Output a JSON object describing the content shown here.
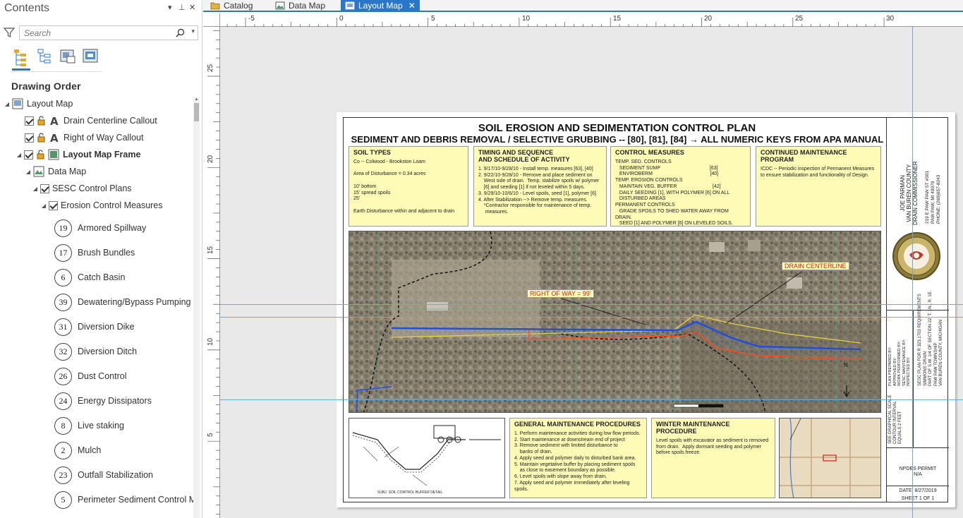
{
  "contents": {
    "title": "Contents",
    "search_placeholder": "Search",
    "drawing_order_label": "Drawing Order",
    "tree": [
      {
        "label": "Layout Map"
      },
      {
        "label": "Drain Centerline Callout"
      },
      {
        "label": "Right of Way Callout"
      },
      {
        "label": "Layout Map Frame"
      },
      {
        "label": "Data Map"
      },
      {
        "label": "SESC Control Plans"
      },
      {
        "label": "Erosion Control Measures"
      }
    ],
    "legend": [
      {
        "num": "19",
        "label": "Armored Spillway"
      },
      {
        "num": "17",
        "label": "Brush Bundles"
      },
      {
        "num": "6",
        "label": "Catch Basin"
      },
      {
        "num": "39",
        "label": "Dewatering/Bypass Pumping"
      },
      {
        "num": "31",
        "label": "Diversion Dike"
      },
      {
        "num": "32",
        "label": "Diversion Ditch"
      },
      {
        "num": "26",
        "label": "Dust Control"
      },
      {
        "num": "24",
        "label": "Energy Dissipators"
      },
      {
        "num": "8",
        "label": "Live staking"
      },
      {
        "num": "2",
        "label": "Mulch"
      },
      {
        "num": "23",
        "label": "Outfall Stabilization"
      },
      {
        "num": "5",
        "label": "Perimeter Sediment Control M"
      }
    ]
  },
  "tabs": [
    {
      "label": "Catalog"
    },
    {
      "label": "Data Map"
    },
    {
      "label": "Layout Map",
      "active": true
    }
  ],
  "rulers": {
    "h_ticks": [
      "-5",
      "0",
      "5",
      "10",
      "15",
      "20",
      "25",
      "30"
    ],
    "v_ticks": [
      "25",
      "20",
      "15",
      "10",
      "5"
    ]
  },
  "sheet": {
    "title": "SOIL EROSION AND SEDIMENTATION CONTROL PLAN",
    "subtitle": "SEDIMENT AND DEBRIS REMOVAL / SELECTIVE GRUBBING -- [80], [81], [84] → ALL NUMERIC KEYS FROM APA MANUAL",
    "boxes": [
      {
        "title": "SOIL TYPES",
        "body": "Co -- Colwood - Brookston Loam\n\nArea of Disturbance = 0.34 acres\n\n10' bottom\n15' spread spoils\n25'\n\nEarth Disturbance within and adjacent to drain"
      },
      {
        "title": "TIMING AND SEQUENCE\nAND SCHEDULE OF ACTIVITY",
        "body": "1. 9/17/10-9/28/10 - Install temp. measures [63], [40]\n2. 9/22/10-9/28/10 - Remove and place sediment on\n    West side of drain.  Temp. stabilize spoils w/ polymer\n    [6] and seeding [1] if not leveled within 5 days.\n3. 9/29/10-10/6/10 - Level spoils, seed [1], polymer [6]\n4. After Stabilization --> Remove temp. measures.\n    *Contractor responsible for maintenance of temp.\n     measures."
      },
      {
        "title": "CONTROL MEASURES",
        "body": "TEMP. SED. CONTROLS\n   SEDIMENT SUMP                                    [63]\n   ENVIROBERM                                          [40]\nTEMP. EROSION CONTROLS\n   MAINTAIN VEG. BUFFER                          [42]\n   DAILY SEEDING [1], WITH POLYMER [6] ON ALL\n   DISTURBED AREAS\nPERMANENT CONTROLS\n   GRADE SPOILS TO SHED WATER AWAY FROM DRAIN.\n   SEED [1] AND POLYMER [6] ON LEVELED SOILS.\n\n**ICDC TO MAINTAIN PERMANENT MEASURES"
      },
      {
        "title": "CONTINUED MAINTENANCE\nPROGRAM",
        "body": "ICDC -- Periodic inspection of Permanent Measures\nto ensure stabilization and functionality of Design."
      },
      {
        "title": "GENERAL MAINTENANCE PROCEDURES",
        "body": "1. Perform maintenance activities during low flow periods.\n2. Start maintenance at downstream end of project\n3. Remove sediment with limited disturbance to\n    banks of drain.\n4. Apply seed and polymer daily to disturbed bank area.\n5. Maintain vegetative buffer by placing sediment spoils\n    as close to easement boundary as possible.\n6. Level spoils with slope away from drain.\n7. Apply seed and polymer immediately after leveling spoils."
      },
      {
        "title": "WINTER MAINTENANCE PROCEDURE",
        "body": "Level spoils with excavator as sediment is removed\nfrom drain.  Apply dormant seeding and polymer\nbefore spoils freeze."
      }
    ],
    "map_labels": {
      "right_of_way": "RIGHT OF WAY = 99'",
      "drain_centerline": "DRAIN CENTERLINE",
      "north": "N"
    },
    "title_block": {
      "commissioner": "JOE PARMAN\nVAN BUREN COUNTY\nDRAIN COMMISSIONER",
      "address": "219 E PAW PAW ST #301\nPAW PAW, MI 49079\nPHONE: (269)657-8243",
      "prepared": "PLAN PREPARED BY:\nAPPROVED BY:\nWORK PERFORMED BY:\nSESC MAINTENANCE BY:\nINSPECTED BY:",
      "project": "SESC PLAN FOR R 323.1703 REQUIREMENTS\nSIMMONS DRAIN\nPART OF S.W. 1/4 OF SECTION 22, T. 1N., R. 1E.\nPAW PAW TOWNSHIP\nVAN BUREN COUNTY, MICHIGAN",
      "scale": "SEE GRAPHICAL SCALE\nCONTOUR INTERVAL\nEQUALS 2 FEET",
      "npdes": "NPDES PERMIT\nN/A",
      "date": "DATE: 8/27/2019",
      "sheet": "SHEET  1 OF 1"
    },
    "sketch_caption": "SUBJ. SOIL CONTROL BUFFER DETAIL"
  }
}
